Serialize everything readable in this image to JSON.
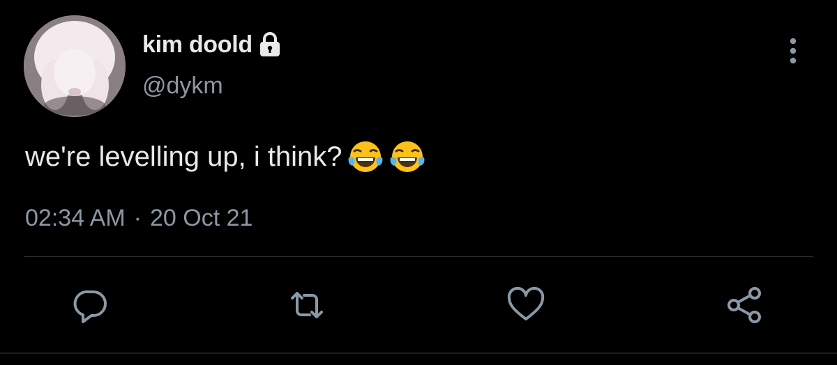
{
  "user": {
    "display_name": "kim doold",
    "handle": "@dykm",
    "avatar_icon": "bunny-avatar",
    "protected_icon": "lock-icon"
  },
  "tweet": {
    "text": "we're levelling up, i think?",
    "emojis": [
      "😂",
      "😂"
    ],
    "time": "02:34 AM",
    "separator": "·",
    "date": "20 Oct 21"
  },
  "actions": {
    "reply_icon": "reply-icon",
    "retweet_icon": "retweet-icon",
    "like_icon": "heart-icon",
    "share_icon": "share-icon",
    "more_icon": "more-vertical-icon"
  },
  "colors": {
    "background": "#000000",
    "primary_text": "#e7e9ea",
    "secondary_text": "#8b98a5",
    "divider": "#2f3336"
  }
}
